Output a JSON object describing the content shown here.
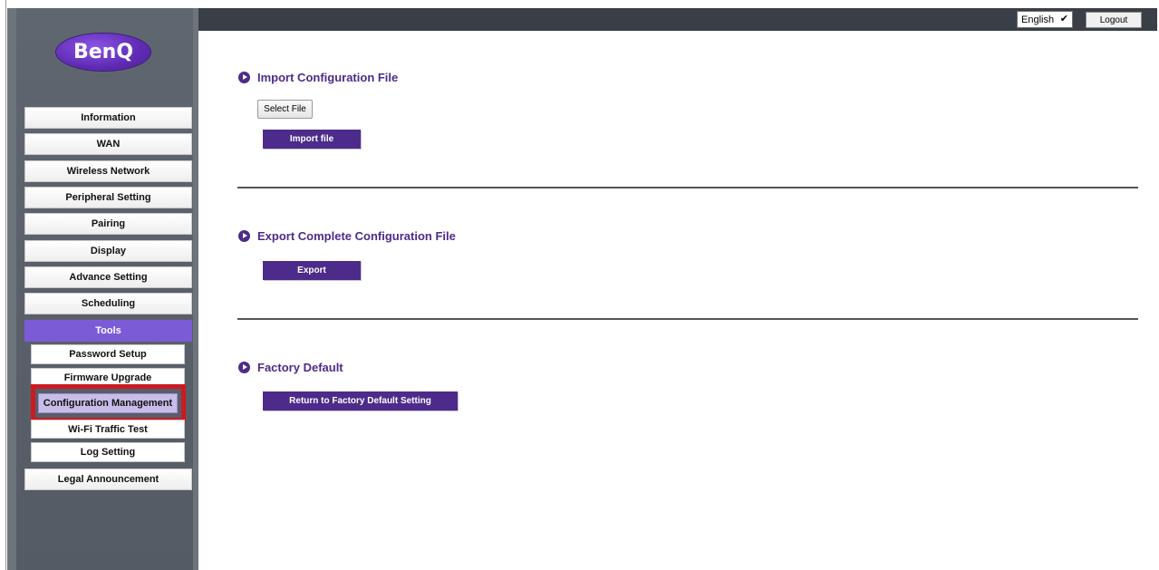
{
  "header": {
    "language": "English",
    "logout_label": "Logout"
  },
  "brand": {
    "logo_text": "BenQ",
    "accent": "#4d2b8a",
    "active_nav": "#7b5cd6"
  },
  "sidebar": {
    "items": [
      {
        "label": "Information"
      },
      {
        "label": "WAN"
      },
      {
        "label": "Wireless Network"
      },
      {
        "label": "Peripheral Setting"
      },
      {
        "label": "Pairing"
      },
      {
        "label": "Display"
      },
      {
        "label": "Advance Setting"
      },
      {
        "label": "Scheduling"
      },
      {
        "label": "Tools"
      },
      {
        "label": "Legal Announcement"
      }
    ],
    "sub_items": [
      {
        "label": "Password Setup"
      },
      {
        "label": "Firmware Upgrade"
      },
      {
        "label": "Configuration Management"
      },
      {
        "label": "Wi-Fi Traffic Test"
      },
      {
        "label": "Log Setting"
      }
    ]
  },
  "main": {
    "import": {
      "title": "Import Configuration File",
      "select_file_label": "Select File",
      "import_label": "Import file"
    },
    "export": {
      "title": "Export Complete Configuration File",
      "export_label": "Export"
    },
    "factory": {
      "title": "Factory Default",
      "reset_label": "Return to Factory Default Setting"
    }
  }
}
